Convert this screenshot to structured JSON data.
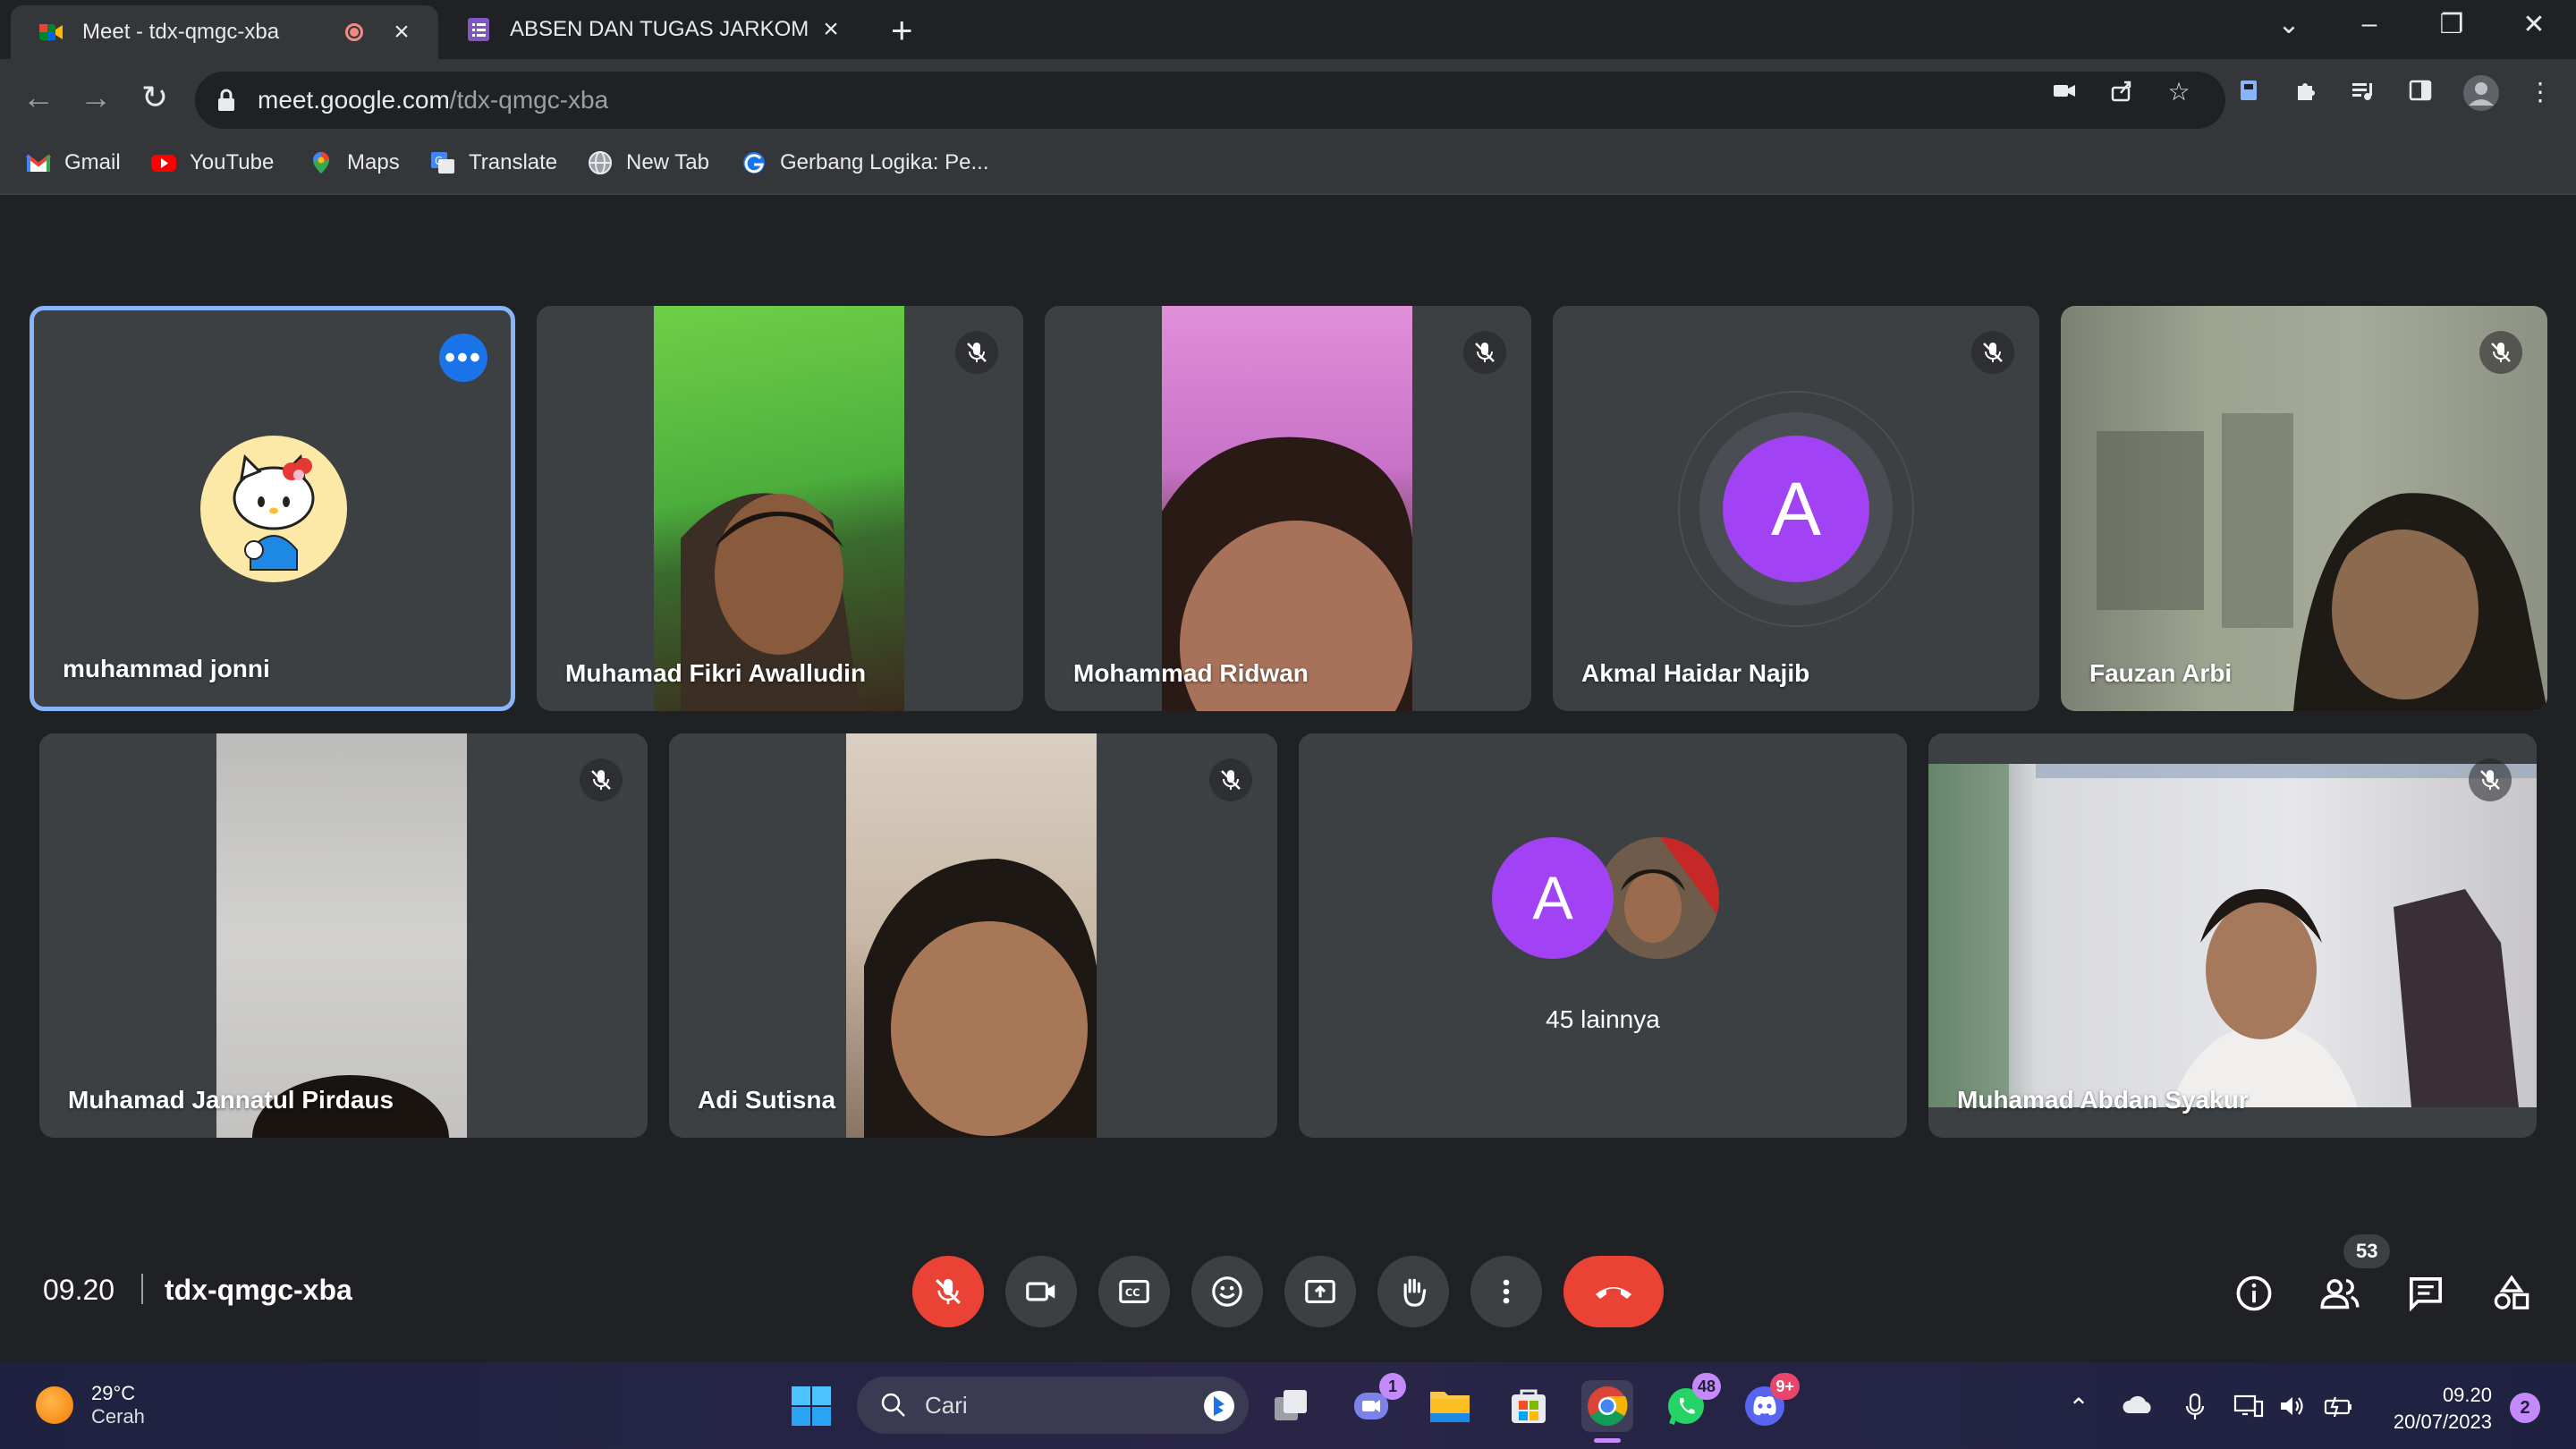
{
  "browser": {
    "tabs": [
      {
        "title": "Meet - tdx-qmgc-xba",
        "active": true
      },
      {
        "title": "ABSEN DAN TUGAS JARKOM",
        "active": false
      }
    ],
    "url_host": "meet.google.com",
    "url_path": "/tdx-qmgc-xba",
    "bookmarks": [
      {
        "label": "Gmail",
        "icon": "gmail-icon"
      },
      {
        "label": "YouTube",
        "icon": "youtube-icon"
      },
      {
        "label": "Maps",
        "icon": "maps-icon"
      },
      {
        "label": "Translate",
        "icon": "translate-icon"
      },
      {
        "label": "New Tab",
        "icon": "globe-icon"
      },
      {
        "label": "Gerbang Logika: Pe...",
        "icon": "page-icon"
      }
    ]
  },
  "meet": {
    "participants": [
      {
        "name": "muhammad jonni"
      },
      {
        "name": "Muhamad Fikri Awalludin"
      },
      {
        "name": "Mohammad Ridwan"
      },
      {
        "name": "Akmal Haidar Najib",
        "avatar_letter": "A"
      },
      {
        "name": "Fauzan Arbi"
      },
      {
        "name": "Muhamad Jannatul Pirdaus"
      },
      {
        "name": "Adi Sutisna"
      },
      {
        "name": "Muhamad Abdan Syakur"
      }
    ],
    "others": {
      "avatar_letter": "A",
      "label": "45 lainnya"
    },
    "time": "09.20",
    "code": "tdx-qmgc-xba",
    "people_count": "53",
    "colors": {
      "accent": "#8ab4f8",
      "danger": "#ea4335",
      "avatar_purple": "#a142f4"
    }
  },
  "taskbar": {
    "weather_temp": "29°C",
    "weather_cond": "Cerah",
    "search_placeholder": "Cari",
    "teams_badge": "1",
    "whatsapp_badge": "48",
    "discord_badge": "9+",
    "clock_time": "09.20",
    "clock_date": "20/07/2023",
    "notif_count": "2"
  }
}
